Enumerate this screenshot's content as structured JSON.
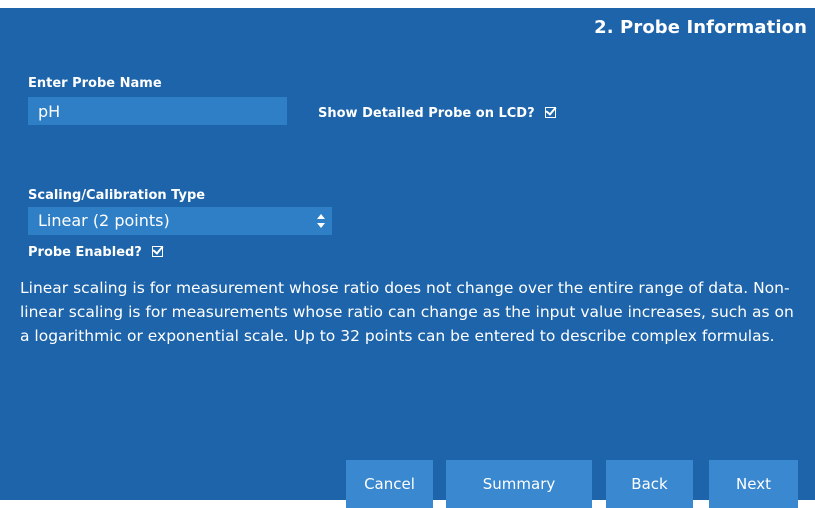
{
  "header": {
    "step_title": "2. Probe Information"
  },
  "probe_name": {
    "label": "Enter Probe Name",
    "value": "pH"
  },
  "show_detailed": {
    "label": "Show Detailed Probe on LCD?",
    "checked": true
  },
  "scaling": {
    "label": "Scaling/Calibration Type",
    "selected": "Linear (2 points)"
  },
  "probe_enabled": {
    "label": "Probe Enabled?",
    "checked": true
  },
  "description": "Linear scaling is for measurement whose ratio does not change over the entire range of data. Non-linear scaling is for measurements whose ratio can change as the input value increases, such as on a logarithmic or exponential scale. Up to 32 points can be entered to describe complex formulas.",
  "buttons": {
    "cancel": "Cancel",
    "summary": "Summary",
    "back": "Back",
    "next": "Next"
  },
  "colors": {
    "panel_bg": "#1d64aa",
    "field_bg": "#2f7fc7",
    "button_bg": "#3a88cf",
    "text": "#ffffff"
  },
  "icons": {
    "checkbox": "checkbox-checked-icon",
    "select": "select-updown-arrows-icon"
  }
}
